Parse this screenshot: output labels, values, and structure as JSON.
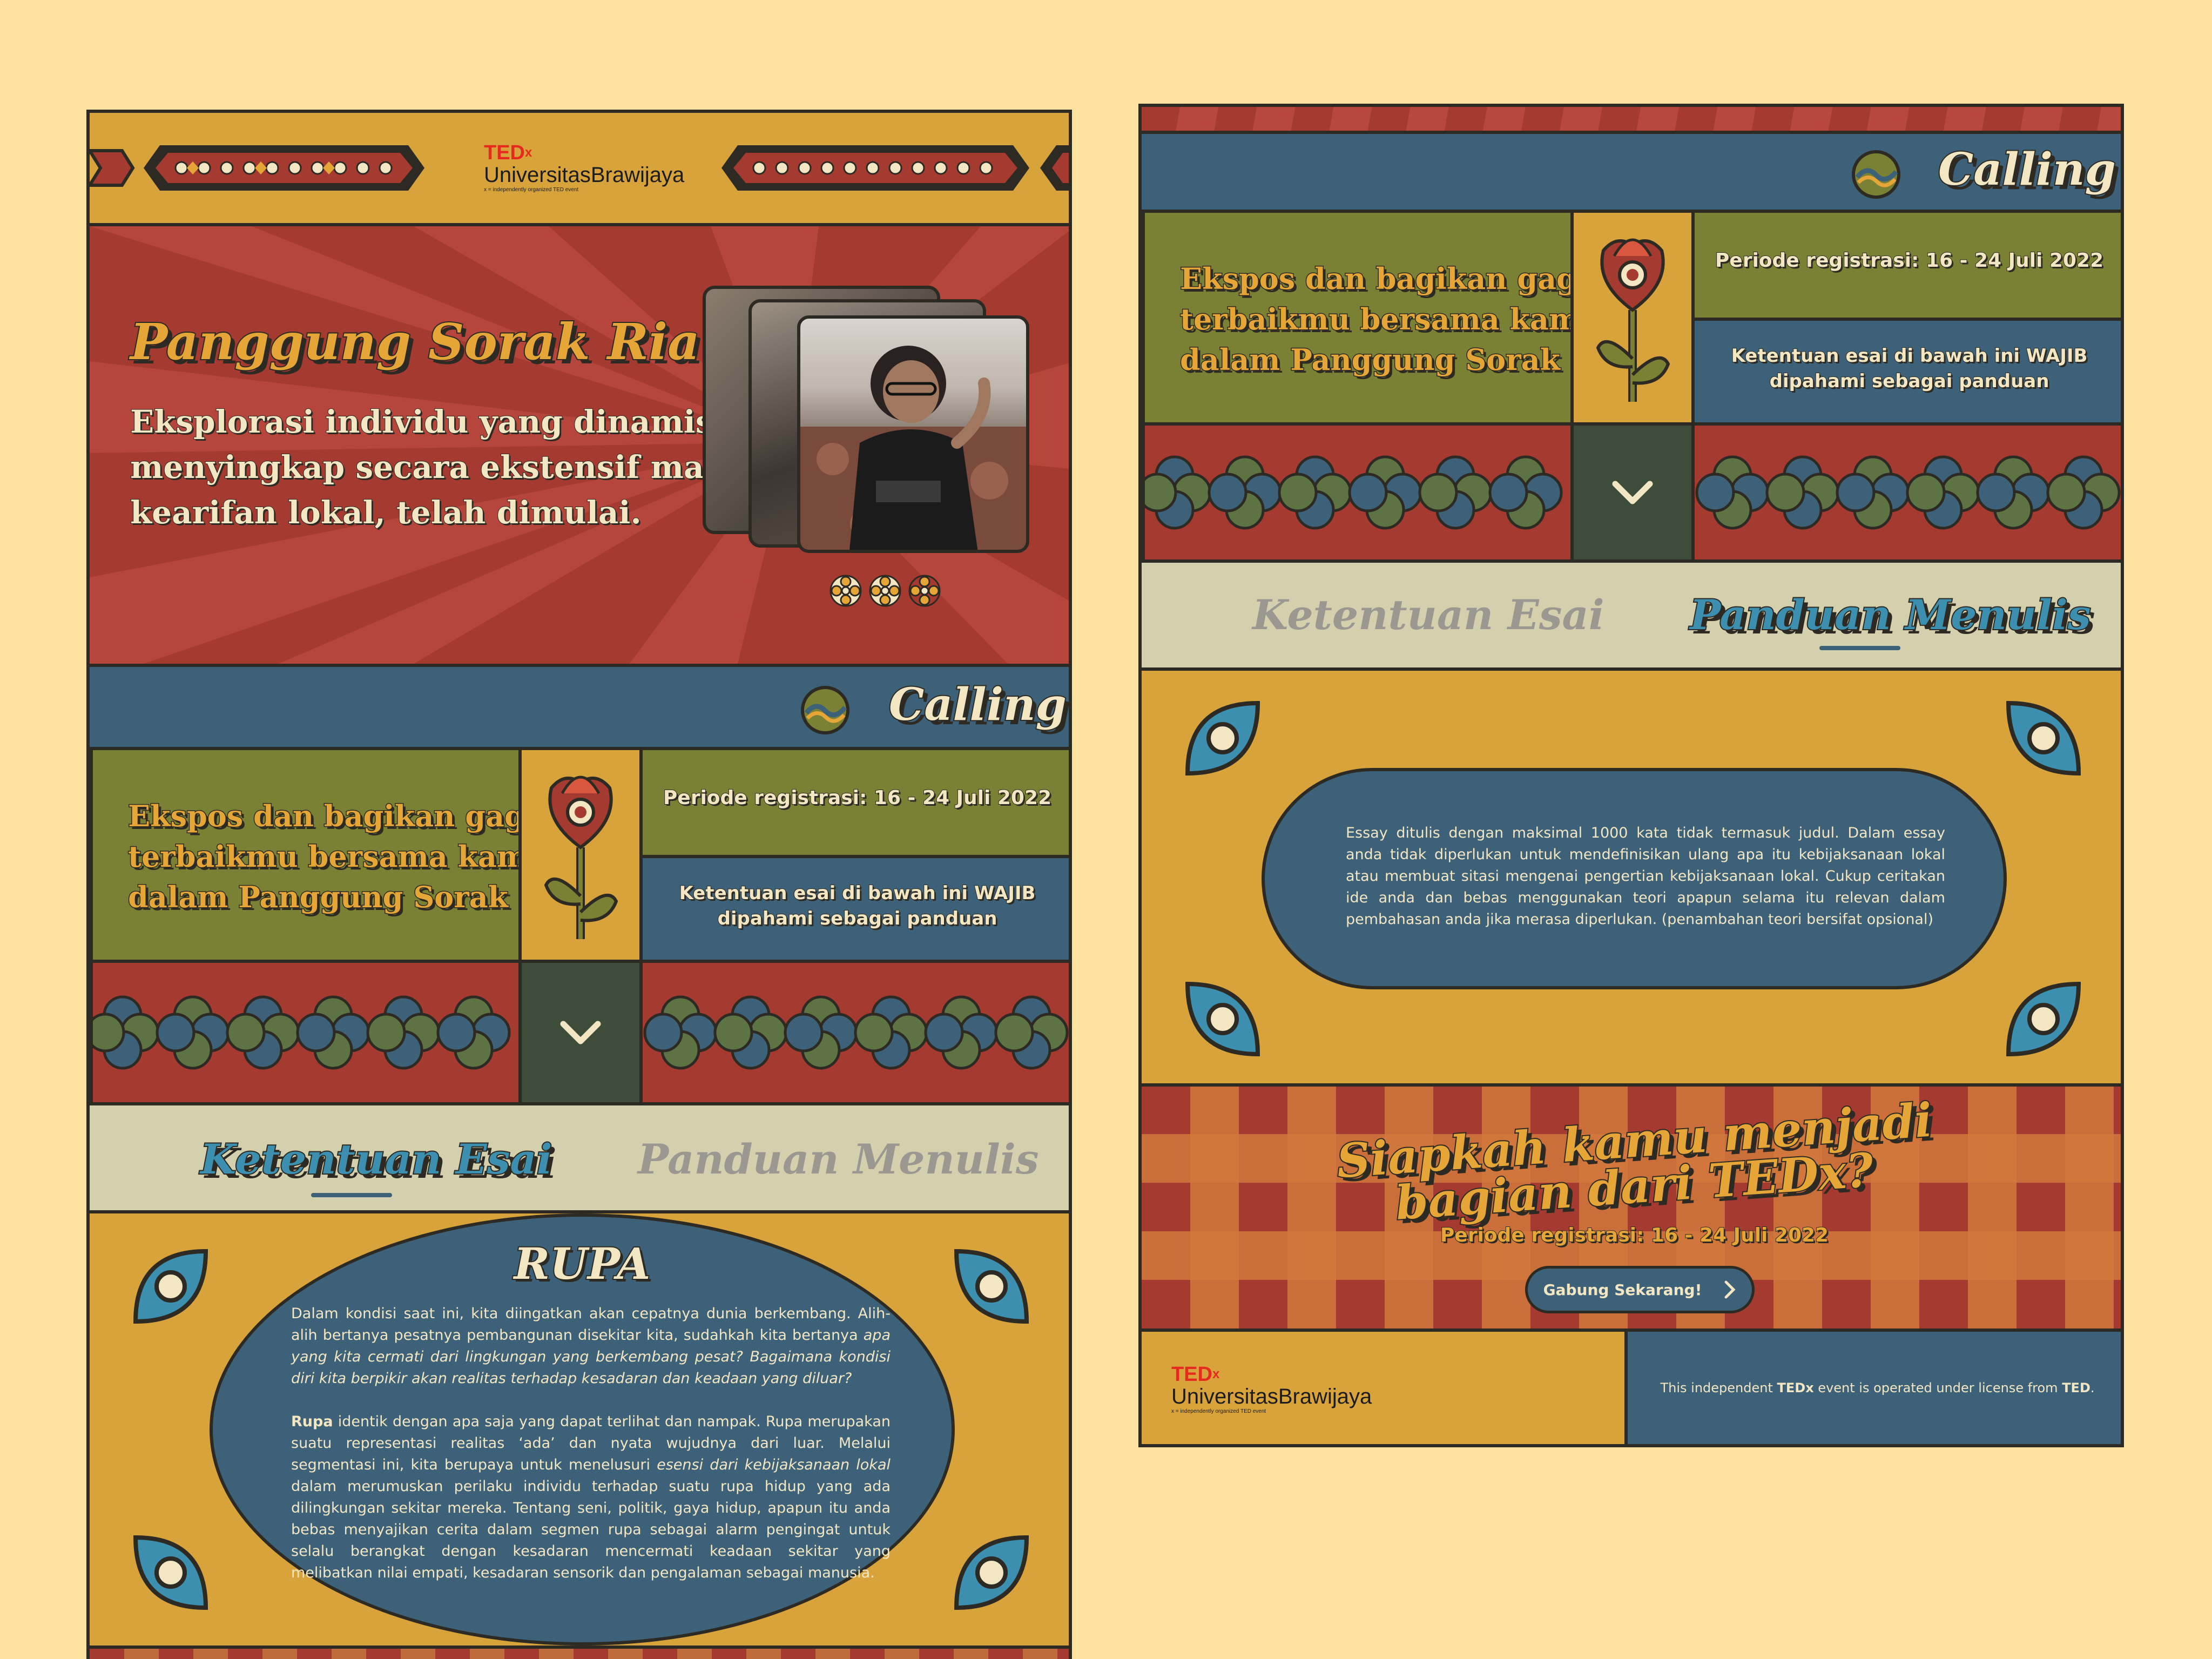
{
  "colors": {
    "background": "#FEE2A0",
    "mustard": "#d9a33b",
    "brick_red": "#a53a31",
    "slate_blue": "#3d6178",
    "olive": "#7b8134",
    "dark_green": "#3d4d3a",
    "cream": "#d4d0ae",
    "outline": "#2c2a22"
  },
  "logo": {
    "ted": "TED",
    "x": "x",
    "name": "UniversitasBrawijaya",
    "tagline": "x = independently organized TED event"
  },
  "hero": {
    "title": "Panggung Sorak Ria",
    "subtitle_lines": [
      "Eksplorasi individu yang dinamis dalam",
      "menyingkap secara ekstensif makna",
      "kearifan lokal, telah dimulai."
    ]
  },
  "marquee": {
    "text": "Calling fo"
  },
  "invite": {
    "lines": [
      "Ekspos dan bagikan gagasan",
      "terbaikmu bersama kami",
      "dalam Panggung Sorak Ria."
    ],
    "period": "Periode registrasi: 16 - 24 Juli 2022",
    "rule_lines": [
      "Ketentuan esai di bawah ini WAJIB",
      "dipahami sebagai panduan"
    ]
  },
  "tabs": {
    "essay_rules": "Ketentuan Esai",
    "writing_guide": "Panduan Menulis"
  },
  "rupa": {
    "title": "RUPA",
    "p1_lead": "Dalam kondisi saat ini, kita diingatkan akan cepatnya dunia berkembang. Alih-alih bertanya pesatnya pembangunan disekitar kita, sudahkah kita bertanya ",
    "p1_italic": "apa yang kita cermati dari lingkungan yang berkembang pesat? Bagaimana kondisi diri kita berpikir akan realitas terhadap kesadaran dan keadaan yang diluar?",
    "p2_bold": "Rupa",
    "p2_text1": " identik dengan apa saja yang dapat terlihat dan nampak. Rupa merupakan suatu representasi realitas ‘ada’ dan nyata wujudnya dari luar. Melalui segmentasi ini, kita berupaya untuk menelusuri ",
    "p2_italic": "esensi dari kebijaksanaan lokal",
    "p2_text2": " dalam merumuskan perilaku individu terhadap suatu rupa hidup yang ada dilingkungan sekitar mereka. Tentang seni, politik, gaya hidup, apapun itu anda bebas menyajikan cerita dalam segmen rupa sebagai alarm pengingat untuk selalu berangkat dengan kesadaran mencermati keadaan sekitar yang  melibatkan nilai empati, kesadaran sensorik dan pengalaman sebagai manusia."
  },
  "guide": {
    "text": "Essay ditulis dengan maksimal 1000 kata tidak termasuk judul. Dalam essay anda tidak diperlukan untuk mendefinisikan ulang apa itu kebijaksanaan lokal atau membuat sitasi mengenai pengertian kebijaksanaan lokal. Cukup ceritakan ide anda dan bebas menggunakan teori apapun selama itu relevan dalam pembahasan anda jika merasa diperlukan. (penambahan teori bersifat opsional)"
  },
  "cta": {
    "line1": "Siapkah kamu menjadi",
    "line2": "bagian dari TEDx?",
    "period": "Periode registrasi: 16 - 24 Juli 2022",
    "button": "Gabung Sekarang!"
  },
  "footer": {
    "license_pre": "This independent ",
    "license_tedx": "TEDx",
    "license_mid": " event is operated under license from ",
    "license_ted": "TED",
    "license_end": "."
  }
}
